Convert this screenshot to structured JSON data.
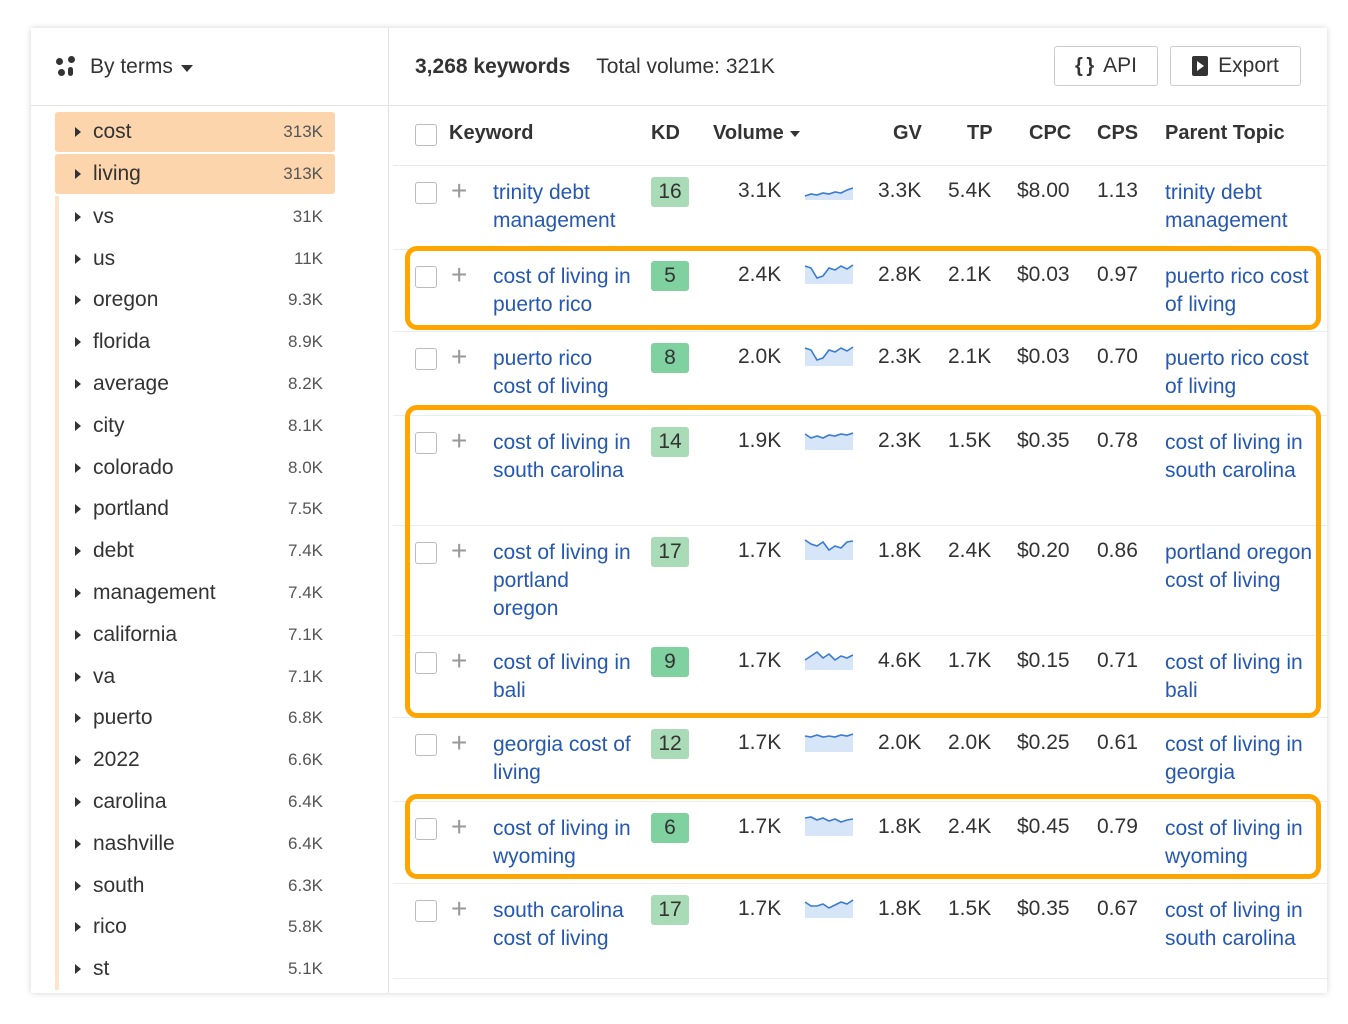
{
  "sidebar": {
    "group_label": "By terms",
    "items": [
      {
        "label": "cost",
        "count": "313K",
        "selected": true
      },
      {
        "label": "living",
        "count": "313K",
        "selected": true
      },
      {
        "label": "vs",
        "count": "31K"
      },
      {
        "label": "us",
        "count": "11K"
      },
      {
        "label": "oregon",
        "count": "9.3K"
      },
      {
        "label": "florida",
        "count": "8.9K"
      },
      {
        "label": "average",
        "count": "8.2K"
      },
      {
        "label": "city",
        "count": "8.1K"
      },
      {
        "label": "colorado",
        "count": "8.0K"
      },
      {
        "label": "portland",
        "count": "7.5K"
      },
      {
        "label": "debt",
        "count": "7.4K"
      },
      {
        "label": "management",
        "count": "7.4K"
      },
      {
        "label": "california",
        "count": "7.1K"
      },
      {
        "label": "va",
        "count": "7.1K"
      },
      {
        "label": "puerto",
        "count": "6.8K"
      },
      {
        "label": "2022",
        "count": "6.6K"
      },
      {
        "label": "carolina",
        "count": "6.4K"
      },
      {
        "label": "nashville",
        "count": "6.4K"
      },
      {
        "label": "south",
        "count": "6.3K"
      },
      {
        "label": "rico",
        "count": "5.8K"
      },
      {
        "label": "st",
        "count": "5.1K"
      }
    ]
  },
  "topbar": {
    "keyword_count": "3,268 keywords",
    "total_volume": "Total volume: 321K",
    "api_label": "API",
    "export_label": "Export"
  },
  "table": {
    "headers": {
      "keyword": "Keyword",
      "kd": "KD",
      "volume": "Volume",
      "gv": "GV",
      "tp": "TP",
      "cpc": "CPC",
      "cps": "CPS",
      "parent": "Parent Topic"
    },
    "rows": [
      {
        "keyword": "trinity debt management",
        "kd": "16",
        "volume": "3.1K",
        "gv": "3.3K",
        "tp": "5.4K",
        "cpc": "$8.00",
        "cps": "1.13",
        "parent": "trinity debt management"
      },
      {
        "keyword": "cost of living in puerto rico",
        "kd": "5",
        "volume": "2.4K",
        "gv": "2.8K",
        "tp": "2.1K",
        "cpc": "$0.03",
        "cps": "0.97",
        "parent": "puerto rico cost of living"
      },
      {
        "keyword": "puerto rico cost of living",
        "kd": "8",
        "volume": "2.0K",
        "gv": "2.3K",
        "tp": "2.1K",
        "cpc": "$0.03",
        "cps": "0.70",
        "parent": "puerto rico cost of living"
      },
      {
        "keyword": "cost of living in south carolina",
        "kd": "14",
        "volume": "1.9K",
        "gv": "2.3K",
        "tp": "1.5K",
        "cpc": "$0.35",
        "cps": "0.78",
        "parent": "cost of living in south carolina"
      },
      {
        "keyword": "cost of living in portland oregon",
        "kd": "17",
        "volume": "1.7K",
        "gv": "1.8K",
        "tp": "2.4K",
        "cpc": "$0.20",
        "cps": "0.86",
        "parent": "portland oregon cost of living"
      },
      {
        "keyword": "cost of living in bali",
        "kd": "9",
        "volume": "1.7K",
        "gv": "4.6K",
        "tp": "1.7K",
        "cpc": "$0.15",
        "cps": "0.71",
        "parent": "cost of living in bali"
      },
      {
        "keyword": "georgia cost of living",
        "kd": "12",
        "volume": "1.7K",
        "gv": "2.0K",
        "tp": "2.0K",
        "cpc": "$0.25",
        "cps": "0.61",
        "parent": "cost of living in georgia"
      },
      {
        "keyword": "cost of living in wyoming",
        "kd": "6",
        "volume": "1.7K",
        "gv": "1.8K",
        "tp": "2.4K",
        "cpc": "$0.45",
        "cps": "0.79",
        "parent": "cost of living in wyoming"
      },
      {
        "keyword": "south carolina cost of living",
        "kd": "17",
        "volume": "1.7K",
        "gv": "1.8K",
        "tp": "1.5K",
        "cpc": "$0.35",
        "cps": "0.67",
        "parent": "cost of living in south carolina"
      }
    ]
  },
  "colors": {
    "kd_easy": "#7fd1a0",
    "kd_low": "#a8dbb6",
    "link": "#2558b3",
    "highlight": "#ffa500",
    "selected_term": "#fdd5ad"
  }
}
